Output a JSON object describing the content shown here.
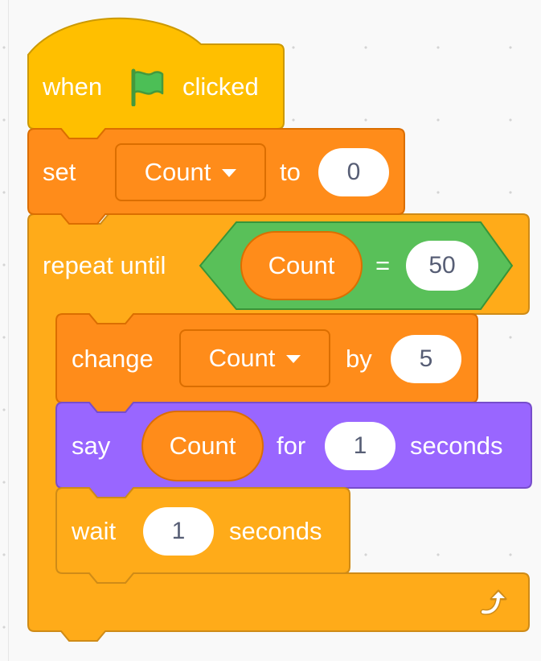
{
  "hat_block": {
    "word_before": "when",
    "icon": "green-flag-icon",
    "word_after": "clicked"
  },
  "set_block": {
    "label": "set",
    "variable": "Count",
    "to_label": "to",
    "value": "0"
  },
  "repeat_block": {
    "label": "repeat until",
    "condition": {
      "left_variable": "Count",
      "operator": "=",
      "right_value": "50"
    },
    "loop_icon": "loop-arrow-icon"
  },
  "change_block": {
    "label": "change",
    "variable": "Count",
    "by_label": "by",
    "value": "5"
  },
  "say_block": {
    "label": "say",
    "variable": "Count",
    "for_label": "for",
    "value": "1",
    "unit": "seconds"
  },
  "wait_block": {
    "label": "wait",
    "value": "1",
    "unit": "seconds"
  },
  "colors": {
    "events": "#ffbf00",
    "variables": "#ff8c1a",
    "control": "#ffab19",
    "looks": "#9966ff",
    "operators": "#59c059",
    "flag": "#4cbf56"
  }
}
